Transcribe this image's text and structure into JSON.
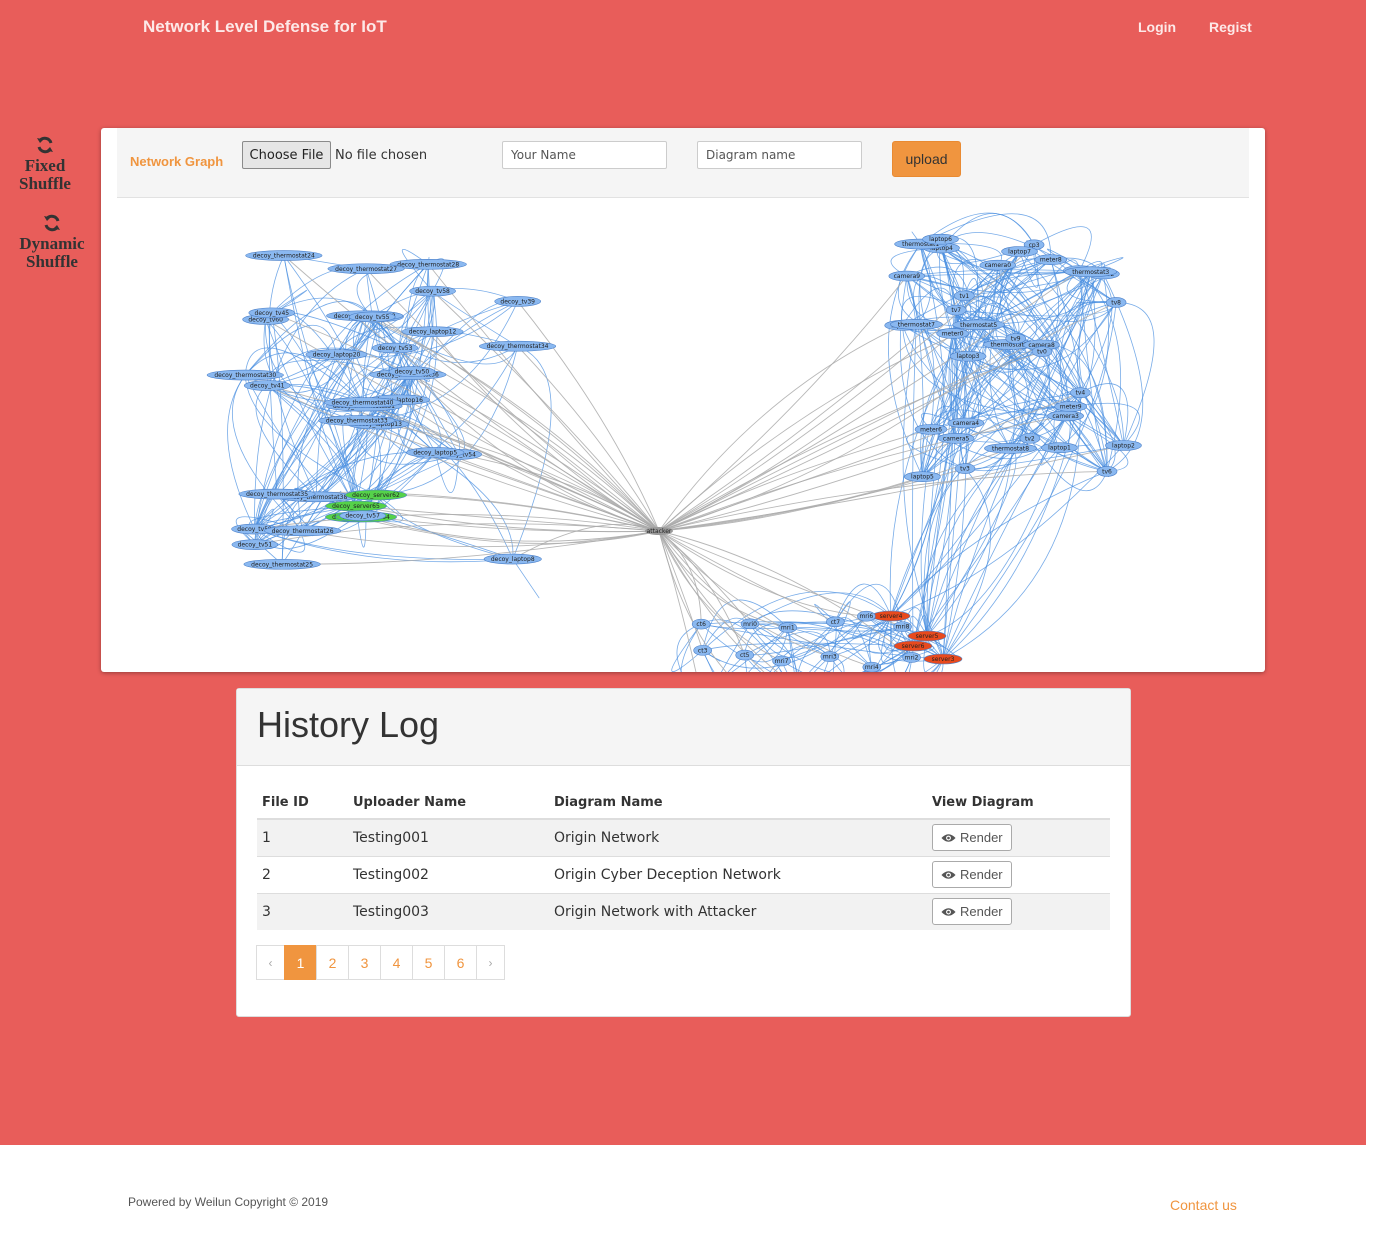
{
  "navbar": {
    "brand": "Network Level Defense for IoT",
    "login": "Login",
    "regist": "Regist"
  },
  "sidebar": {
    "fixed_line1": "Fixed",
    "fixed_line2": "Shuffle",
    "dynamic_line1": "Dynamic",
    "dynamic_line2": "Shuffle"
  },
  "upload": {
    "label": "Network Graph",
    "file_button": "Choose File",
    "file_status": "No file chosen",
    "name_placeholder": "Your Name",
    "diagram_placeholder": "Diagram name",
    "upload_button": "upload"
  },
  "graph": {
    "center_node": "attacker",
    "decoy_nodes": [
      "decoy_laptop13",
      "decoy_tv60",
      "decoy_thermostat31",
      "decoy_tv59",
      "decoy_thermostat36",
      "decoy_thermostat38",
      "decoy_thermostat28",
      "decoy_tv43",
      "decoy_tv58",
      "decoy_laptop16",
      "decoy_thermostat24",
      "decoy_laptop8",
      "decoy_tv41",
      "decoy_tv39",
      "decoy_thermostat33",
      "decoy_server63",
      "decoy_laptop12",
      "decoy_server62",
      "decoy_server65",
      "decoy_server64",
      "decoy_thermostat25",
      "decoy_thermostat32",
      "decoy_tv53",
      "decoy_thermostat35",
      "decoy_laptop20",
      "decoy_tv51",
      "decoy_thermostat26",
      "decoy_tv55",
      "decoy_tv50",
      "decoy_tv54",
      "decoy_tv45",
      "decoy_thermostat27",
      "decoy_thermostat30",
      "decoy_laptop5",
      "decoy_thermostat34",
      "decoy_thermostat40",
      "decoy_tv57"
    ],
    "real_nodes": [
      "thermostat2",
      "tv1",
      "meter5",
      "camera4",
      "tv6",
      "laptop2",
      "tv4",
      "cp3",
      "thermostat5",
      "meter0",
      "camera3",
      "tv3",
      "laptop0",
      "camera8",
      "laptop5",
      "thermostat8",
      "tv0",
      "meter6",
      "tv8",
      "camera9",
      "meter9",
      "laptop1",
      "camera5",
      "laptop4",
      "thermostat1",
      "tv2",
      "meter2",
      "laptop7",
      "laptop3",
      "thermostat7",
      "tv7",
      "thermostat3",
      "laptop6",
      "meter8",
      "camera0",
      "tv9"
    ],
    "server_nodes": [
      "server4",
      "server5",
      "server6",
      "server3"
    ],
    "medical_nodes": [
      "ct6",
      "mri0",
      "mri1",
      "ct7",
      "mri6",
      "mri8",
      "ct3",
      "ct5",
      "mri7",
      "mri3",
      "mri4",
      "mri2",
      "ct1",
      "ct8",
      "mri9",
      "mri5"
    ]
  },
  "history": {
    "title": "History Log",
    "headers": [
      "File ID",
      "Uploader Name",
      "Diagram Name",
      "View Diagram"
    ],
    "rows": [
      {
        "id": "1",
        "uploader": "Testing001",
        "diagram": "Origin Network",
        "action": "Render"
      },
      {
        "id": "2",
        "uploader": "Testing002",
        "diagram": "Origin Cyber Deception Network",
        "action": "Render"
      },
      {
        "id": "3",
        "uploader": "Testing003",
        "diagram": "Origin Network with Attacker",
        "action": "Render"
      }
    ],
    "pagination": [
      "‹",
      "1",
      "2",
      "3",
      "4",
      "5",
      "6",
      "›"
    ],
    "active_page": "1"
  },
  "footer": {
    "copyright": "Powered by Weilun Copyright © 2019",
    "contact": "Contact us"
  },
  "colors": {
    "background": "#e85d5a",
    "accent": "#f0953f",
    "node_blue": "#8ab8f0",
    "edge_blue": "#4a8fe0",
    "node_green": "#55d24a",
    "node_red": "#e84a1e",
    "attacker_gray": "#999999"
  }
}
